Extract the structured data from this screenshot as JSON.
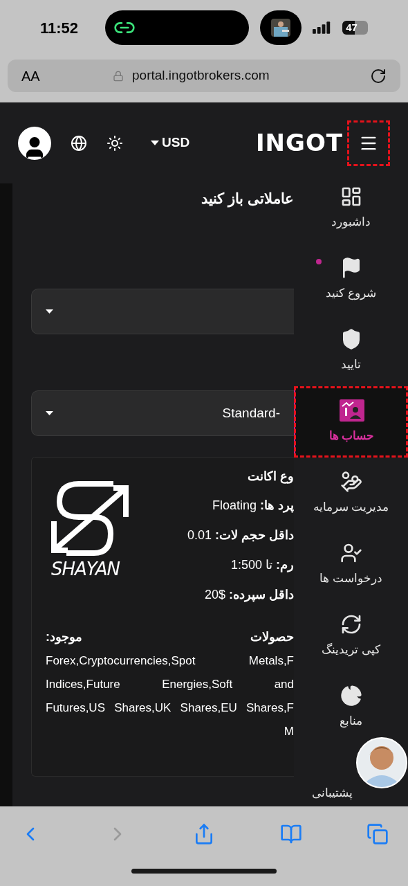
{
  "status_bar": {
    "time": "11:52",
    "battery": "47"
  },
  "address_bar": {
    "text_size": "AA",
    "url": "portal.ingotbrokers.com"
  },
  "header": {
    "currency": "USD",
    "logo": "INGOT",
    "menu_highlighted": true
  },
  "main": {
    "title": "عاملاتی باز کنید",
    "selects": [
      {
        "kind": "empty"
      },
      {
        "kind": "filled",
        "value": "Standard-"
      }
    ],
    "card": {
      "logo_text": "SHAYAN",
      "rows": [
        {
          "label": "وع اکانت"
        },
        {
          "label": "پرد ها:",
          "value": "Floating"
        },
        {
          "label": "داقل حجم لات:",
          "value": "0.01"
        },
        {
          "label": "رم:",
          "value": "تا 1:500"
        },
        {
          "label": "داقل سپرده:",
          "value": "20$"
        }
      ],
      "products_label_right": "حصولات",
      "products_label_left": "موجود:",
      "products_lines": [
        "Forex,Cryptocurrencies,Spot Metals,F",
        "Indices,Future Energies,Soft and",
        "Futures,US Shares,UK Shares,EU Shares,F",
        "M"
      ]
    }
  },
  "sidebar": {
    "items": [
      {
        "kind": "dashboard",
        "label": "داشبورد",
        "selected": false,
        "dot": false,
        "highlighted": false
      },
      {
        "kind": "flag",
        "label": "شروع کنید",
        "selected": false,
        "dot": true,
        "highlighted": false
      },
      {
        "kind": "shield",
        "label": "تایید",
        "selected": false,
        "dot": false,
        "highlighted": false
      },
      {
        "kind": "accounts",
        "label": "حساب ها",
        "selected": true,
        "dot": false,
        "highlighted": true
      },
      {
        "kind": "funds",
        "label": "مدیریت سرمایه",
        "selected": false,
        "dot": false,
        "highlighted": false
      },
      {
        "kind": "requests",
        "label": "درخواست ها",
        "selected": false,
        "dot": false,
        "highlighted": false
      },
      {
        "kind": "copy",
        "label": "کپی تریدینگ",
        "selected": false,
        "dot": false,
        "highlighted": false
      },
      {
        "kind": "resources",
        "label": "منابع",
        "selected": false,
        "dot": false,
        "highlighted": false
      },
      {
        "kind": "support",
        "label": "پشتیبانی",
        "selected": false,
        "dot": false,
        "highlighted": false
      }
    ]
  }
}
